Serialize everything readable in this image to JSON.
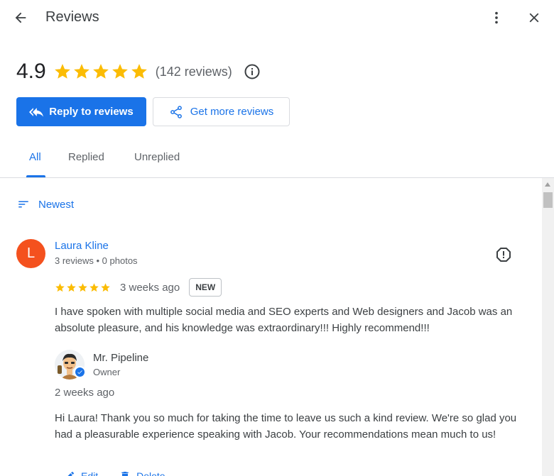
{
  "header": {
    "title": "Reviews",
    "back_icon": "arrow-back-icon",
    "more_icon": "more-vert-icon",
    "close_icon": "close-icon"
  },
  "summary": {
    "rating": "4.9",
    "stars": 5,
    "review_count": "(142 reviews)",
    "info_icon": "info-icon"
  },
  "actions": {
    "reply_label": "Reply to reviews",
    "get_more_label": "Get more reviews"
  },
  "tabs": [
    {
      "label": "All",
      "active": true
    },
    {
      "label": "Replied",
      "active": false
    },
    {
      "label": "Unreplied",
      "active": false
    }
  ],
  "sort": {
    "label": "Newest"
  },
  "review": {
    "avatar_letter": "L",
    "avatar_color": "#f4511e",
    "name": "Laura Kline",
    "meta": "3 reviews • 0 photos",
    "stars": 5,
    "date": "3 weeks ago",
    "badge": "NEW",
    "text": "I have spoken with multiple social media and SEO experts and Web designers and Jacob was an absolute pleasure, and his knowledge was extraordinary!!! Highly recommend!!!",
    "reply": {
      "owner_name": "Mr. Pipeline",
      "owner_role": "Owner",
      "date": "2 weeks ago",
      "text": "Hi Laura! Thank you so much for taking the time to leave us such a kind review. We're so glad you had a pleasurable experience speaking with Jacob. Your recommendations mean much to us!",
      "actions": [
        "Edit",
        "Delete"
      ]
    }
  },
  "colors": {
    "accent": "#1a73e8",
    "star": "#fbbc04",
    "text_secondary": "#5f6368"
  }
}
